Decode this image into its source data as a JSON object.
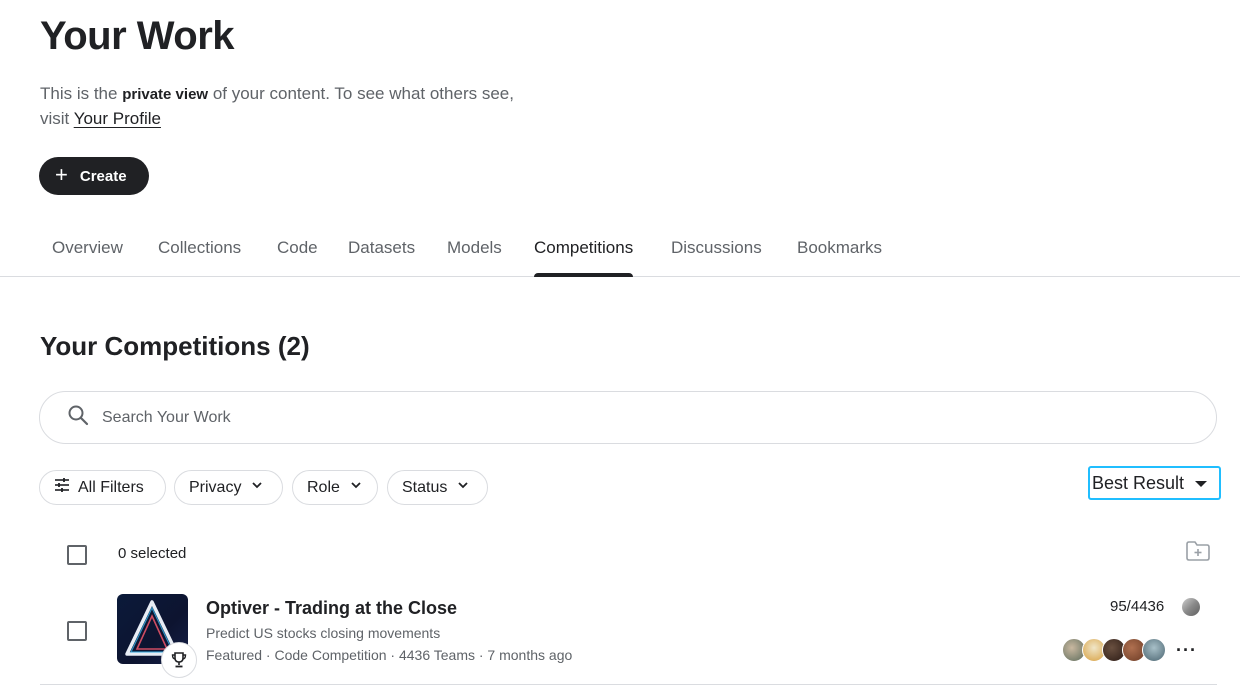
{
  "header": {
    "title": "Your Work",
    "intro_prefix": "This is the ",
    "intro_bold": "private view",
    "intro_suffix": " of your content. To see what others see,",
    "intro_line2_prefix": "visit ",
    "profile_link": "Your Profile"
  },
  "create_button": {
    "label": "Create",
    "icon": "plus-icon"
  },
  "tabs": [
    {
      "label": "Overview",
      "active": false
    },
    {
      "label": "Collections",
      "active": false
    },
    {
      "label": "Code",
      "active": false
    },
    {
      "label": "Datasets",
      "active": false
    },
    {
      "label": "Models",
      "active": false
    },
    {
      "label": "Competitions",
      "active": true
    },
    {
      "label": "Discussions",
      "active": false
    },
    {
      "label": "Bookmarks",
      "active": false
    }
  ],
  "section": {
    "title": "Your Competitions (2)"
  },
  "search": {
    "placeholder": "Search Your Work",
    "value": "",
    "icon": "search-icon"
  },
  "filters": {
    "all_filters": "All Filters",
    "privacy": "Privacy",
    "role": "Role",
    "status": "Status"
  },
  "sort": {
    "selected": "Best Result"
  },
  "selection": {
    "count_label": "0 selected"
  },
  "competitions": [
    {
      "title": "Optiver - Trading at the Close",
      "subtitle": "Predict US stocks closing movements",
      "meta": "Featured · Code Competition · 4436 Teams · 7 months ago",
      "rank": "95/4436",
      "medal": "silver",
      "badge_icon": "trophy-icon",
      "team_avatar_count": 5
    }
  ],
  "colors": {
    "accent": "#20beff",
    "text_primary": "#202124",
    "text_secondary": "#5f6368",
    "border": "#dadce0"
  }
}
